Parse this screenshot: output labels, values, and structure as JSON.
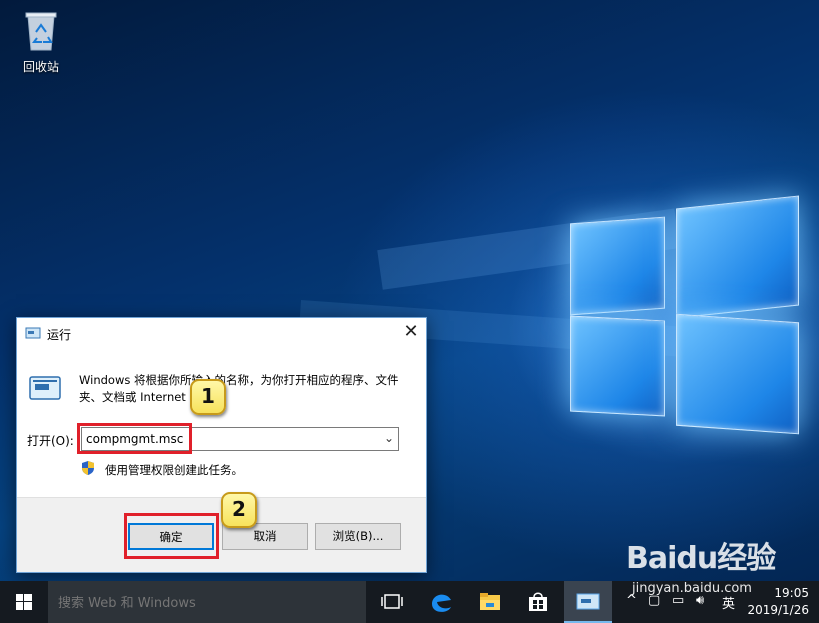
{
  "desktop": {
    "recycle_bin_label": "回收站"
  },
  "run_dialog": {
    "title": "运行",
    "close_label": "✕",
    "description": "Windows 将根据你所输入的名称，为你打开相应的程序、文件夹、文档或 Internet 资源。",
    "open_label": "打开(O):",
    "command_value": "compmgmt.msc",
    "admin_note": "使用管理权限创建此任务。",
    "buttons": {
      "ok": "确定",
      "cancel": "取消",
      "browse": "浏览(B)..."
    }
  },
  "annotations": {
    "step1": "1",
    "step2": "2",
    "highlight_color": "#e0202a"
  },
  "taskbar": {
    "search_placeholder": "搜索 Web 和 Windows",
    "icons": [
      "task-view-icon",
      "edge-icon",
      "file-explorer-icon",
      "store-icon",
      "run-icon"
    ],
    "tray": {
      "chevron": "^",
      "ime": "英"
    },
    "clock": {
      "time": "19:05",
      "date": "2019/1/26"
    }
  },
  "watermark": {
    "brand": "Baidu经验",
    "url": "jingyan.baidu.com"
  },
  "colors": {
    "accent": "#0078d7",
    "taskbar": "#151a20"
  }
}
